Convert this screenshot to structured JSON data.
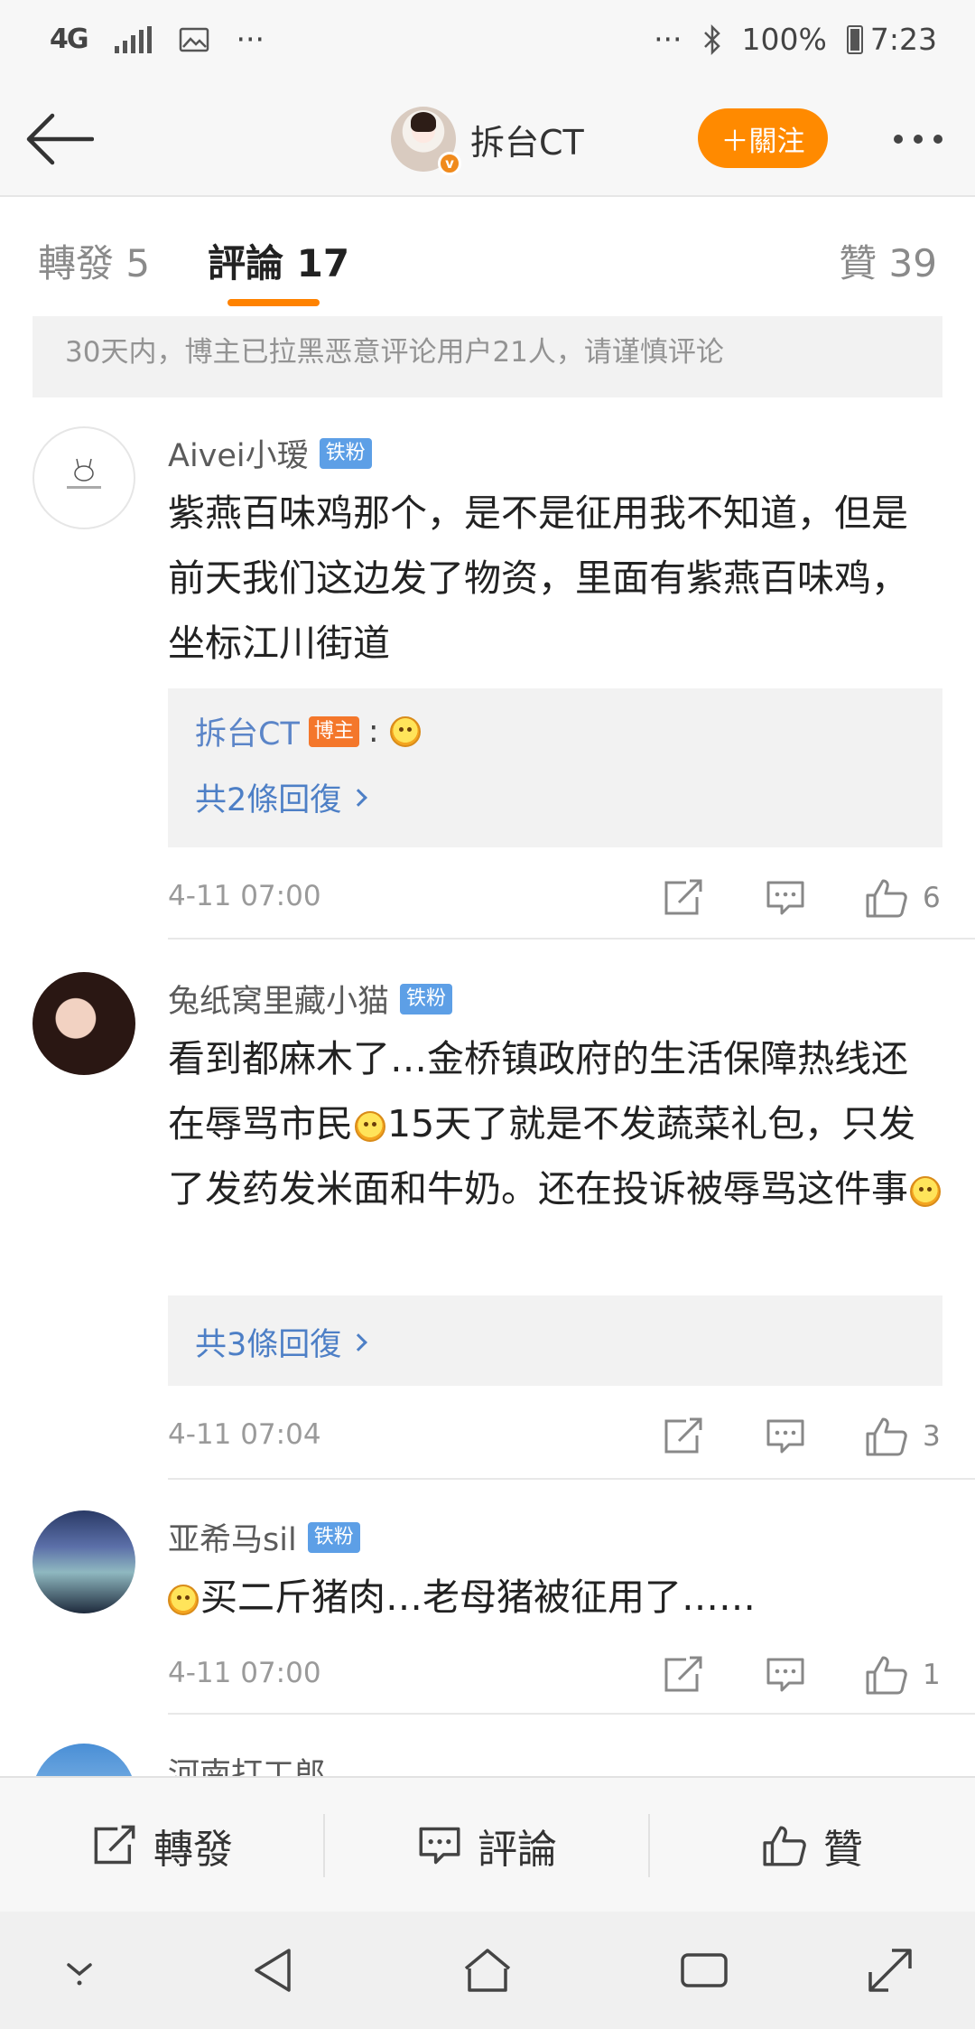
{
  "status_bar": {
    "network": "4G",
    "dots": "···",
    "right_dots": "···",
    "battery": "100%",
    "time": "7:23"
  },
  "header": {
    "title": "拆台CT",
    "follow_label": "＋關注",
    "verified_mark": "v"
  },
  "tabs": [
    {
      "label": "轉發 5"
    },
    {
      "label": "評論 17"
    },
    {
      "label": "贊 39"
    }
  ],
  "notice": "30天内，博主已拉黑恶意评论用户21人，请谨慎评论",
  "comments": [
    {
      "name": "Aivei小瑷",
      "badge": "铁粉",
      "text": "紫燕百味鸡那个，是不是征用我不知道，但是前天我们这边发了物资，里面有紫燕百味鸡，坐标江川街道",
      "reply_author": "拆台CT",
      "reply_badge": "博主",
      "reply_colon": ":",
      "reply_more": "共2條回復",
      "time": "4-11 07:00",
      "likes": "6"
    },
    {
      "name": "兔纸窝里藏小猫",
      "badge": "铁粉",
      "text_1": "看到都麻木了…金桥镇政府的生活保障热线还在辱骂市民",
      "text_2": "15天了就是不发蔬菜礼包，只发了发药发米面和牛奶。还在投诉被辱骂这件事",
      "reply_more": "共3條回復",
      "time": "4-11 07:04",
      "likes": "3"
    },
    {
      "name": "亚希马sil",
      "badge": "铁粉",
      "text": "买二斤猪肉…老母猪被征用了……",
      "time": "4-11 07:00",
      "likes": "1"
    },
    {
      "name": "河南打工郎"
    }
  ],
  "action_bar": {
    "repost": "轉發",
    "comment": "評論",
    "like": "贊"
  },
  "icons": {
    "back": "back-arrow-icon",
    "more": "more-dots-icon",
    "share": "share-icon",
    "comment": "comment-icon",
    "like": "thumbs-up-icon"
  },
  "colors": {
    "accent": "#ff8200",
    "follow": "#ff8a00",
    "link": "#4d7fc6",
    "fan_badge": "#5d9fe6",
    "host_badge": "#f4772b"
  }
}
